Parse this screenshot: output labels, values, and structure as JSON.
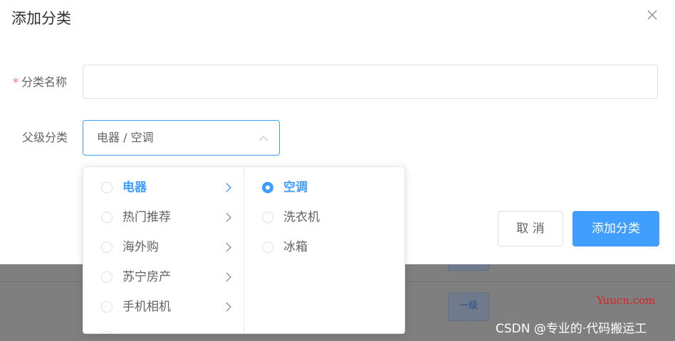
{
  "dialog": {
    "title": "添加分类"
  },
  "form": {
    "name_required_mark": "*",
    "name_label": "分类名称",
    "name_value": "",
    "parent_label": "父级分类",
    "parent_value": "电器 / 空调"
  },
  "cascader": {
    "level1": [
      {
        "label": "电器",
        "active": true
      },
      {
        "label": "热门推荐"
      },
      {
        "label": "海外购"
      },
      {
        "label": "苏宁房产"
      },
      {
        "label": "手机相机"
      }
    ],
    "level2": [
      {
        "label": "空调",
        "selected": true
      },
      {
        "label": "洗衣机"
      },
      {
        "label": "冰箱"
      }
    ]
  },
  "buttons": {
    "cancel": "取 消",
    "submit": "添加分类"
  },
  "background": {
    "level_tag": "一级"
  },
  "watermarks": {
    "site": "Yuucn.com",
    "csdn": "CSDN @专业的·代码搬运工"
  },
  "colors": {
    "primary": "#409eff",
    "required": "#f56c6c",
    "text": "#606266",
    "border": "#dcdfe6"
  }
}
